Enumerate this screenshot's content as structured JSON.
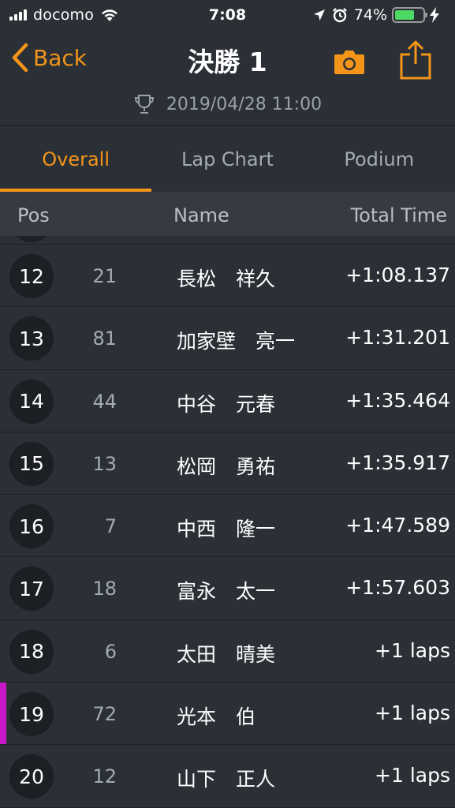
{
  "status_bar": {
    "carrier": "docomo",
    "time": "7:08",
    "battery_percent": "74%",
    "battery_level": 0.74
  },
  "nav": {
    "back_label": "Back",
    "title": "決勝 1",
    "camera_icon": "camera-icon",
    "share_icon": "share-icon"
  },
  "event": {
    "datetime": "2019/04/28 11:00",
    "icon": "trophy-icon"
  },
  "tabs": [
    {
      "label": "Overall",
      "active": true
    },
    {
      "label": "Lap Chart",
      "active": false
    },
    {
      "label": "Podium",
      "active": false
    }
  ],
  "columns": {
    "pos": "Pos",
    "name": "Name",
    "total_time": "Total Time"
  },
  "results": [
    {
      "pos": "12",
      "number": "21",
      "name": "長松　祥久",
      "time": "+1:08.137",
      "highlight": false
    },
    {
      "pos": "13",
      "number": "81",
      "name": "加家壁　亮一",
      "time": "+1:31.201",
      "highlight": false
    },
    {
      "pos": "14",
      "number": "44",
      "name": "中谷　元春",
      "time": "+1:35.464",
      "highlight": false
    },
    {
      "pos": "15",
      "number": "13",
      "name": "松岡　勇祐",
      "time": "+1:35.917",
      "highlight": false
    },
    {
      "pos": "16",
      "number": "7",
      "name": "中西　隆一",
      "time": "+1:47.589",
      "highlight": false
    },
    {
      "pos": "17",
      "number": "18",
      "name": "富永　太一",
      "time": "+1:57.603",
      "highlight": false
    },
    {
      "pos": "18",
      "number": "6",
      "name": "太田　晴美",
      "time": "+1 laps",
      "highlight": false
    },
    {
      "pos": "19",
      "number": "72",
      "name": "光本　伯",
      "time": "+1 laps",
      "highlight": true
    },
    {
      "pos": "20",
      "number": "12",
      "name": "山下　正人",
      "time": "+1 laps",
      "highlight": false
    }
  ],
  "colors": {
    "accent": "#f39519",
    "highlight_marker": "#c718c7",
    "background": "#2b2f36"
  }
}
